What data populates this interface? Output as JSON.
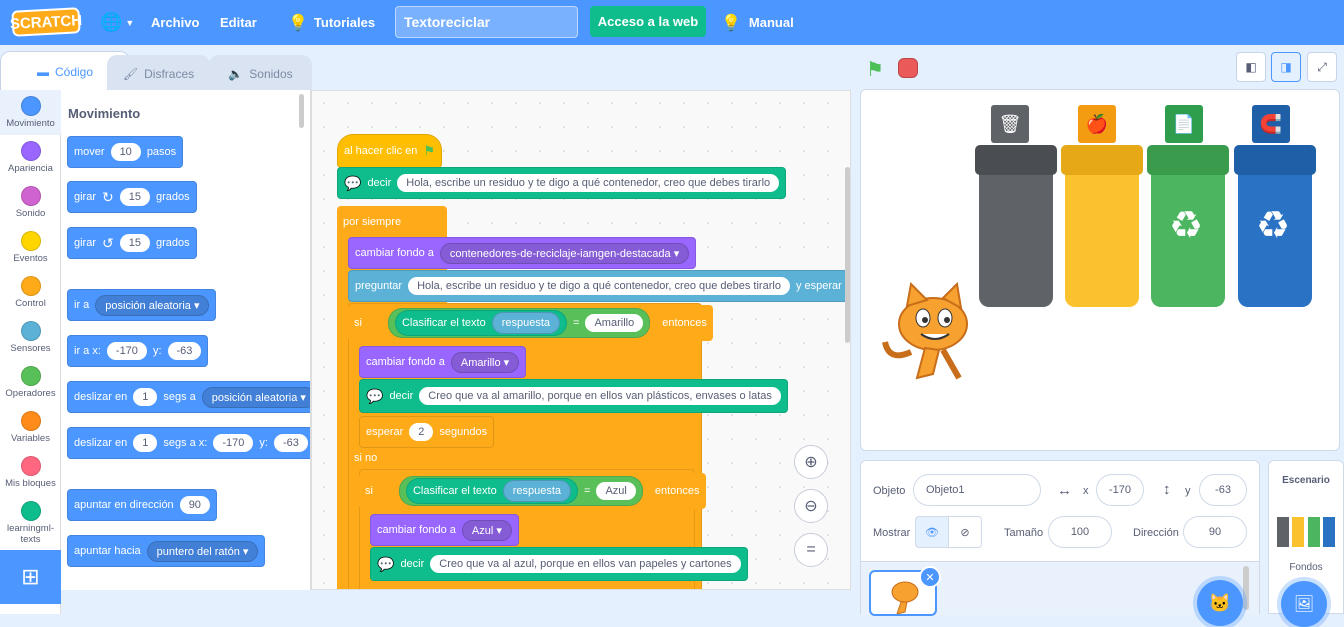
{
  "menubar": {
    "logo": "SCRATCH",
    "archivo": "Archivo",
    "editar": "Editar",
    "tutoriales": "Tutoriales",
    "project_title": "Textoreciclar",
    "web_button": "Acceso a la web",
    "manual": "Manual"
  },
  "tabs": {
    "code": "Código",
    "costumes": "Disfraces",
    "sounds": "Sonidos"
  },
  "categories": [
    {
      "label": "Movimiento",
      "color": "#4c97ff"
    },
    {
      "label": "Apariencia",
      "color": "#9966ff"
    },
    {
      "label": "Sonido",
      "color": "#cf63cf"
    },
    {
      "label": "Eventos",
      "color": "#ffd500"
    },
    {
      "label": "Control",
      "color": "#ffab19"
    },
    {
      "label": "Sensores",
      "color": "#5cb1d6"
    },
    {
      "label": "Operadores",
      "color": "#59c059"
    },
    {
      "label": "Variables",
      "color": "#ff8c1a"
    },
    {
      "label": "Mis bloques",
      "color": "#ff6680"
    },
    {
      "label": "learningml-texts",
      "color": "#0fbd8c"
    }
  ],
  "palette": {
    "heading": "Movimiento",
    "move": {
      "a": "mover",
      "v": "10",
      "b": "pasos"
    },
    "turn_right": {
      "a": "girar",
      "v": "15",
      "b": "grados"
    },
    "turn_left": {
      "a": "girar",
      "v": "15",
      "b": "grados"
    },
    "goto": {
      "a": "ir a",
      "dd": "posición aleatoria"
    },
    "goto_xy": {
      "a": "ir a x:",
      "x": "-170",
      "b": "y:",
      "y": "-63"
    },
    "glide": {
      "a": "deslizar en",
      "v": "1",
      "b": "segs a",
      "dd": "posición aleatoria"
    },
    "glide_xy": {
      "a": "deslizar en",
      "v": "1",
      "b": "segs a x:",
      "x": "-170",
      "c": "y:",
      "y": "-63"
    },
    "point_dir": {
      "a": "apuntar en dirección",
      "v": "90"
    },
    "point_towards": {
      "a": "apuntar hacia",
      "dd": "puntero del ratón"
    }
  },
  "script": {
    "hat": "al hacer clic en",
    "say1": {
      "a": "decir",
      "v": "Hola, escribe un residuo y te digo a qué contenedor, creo que debes tirarlo"
    },
    "forever": "por siempre",
    "switch_bg": {
      "a": "cambiar fondo a",
      "dd": "contenedores-de-reciclaje-iamgen-destacada"
    },
    "ask": {
      "a": "preguntar",
      "v": "Hola, escribe un residuo y te digo a qué contenedor, creo que debes tirarlo",
      "b": "y esperar"
    },
    "if1": {
      "si": "si",
      "classify": "Clasificar el texto",
      "answer": "respuesta",
      "eq": "=",
      "v": "Amarillo",
      "then": "entonces"
    },
    "switch_bg2": {
      "a": "cambiar fondo a",
      "dd": "Amarillo"
    },
    "say2": {
      "a": "decir",
      "v": "Creo que va al amarillo, porque en ellos van plásticos, envases o latas"
    },
    "wait": {
      "a": "esperar",
      "v": "2",
      "b": "segundos"
    },
    "else": "si no",
    "if2": {
      "si": "si",
      "classify": "Clasificar el texto",
      "answer": "respuesta",
      "eq": "=",
      "v": "Azul",
      "then": "entonces"
    },
    "switch_bg3": {
      "a": "cambiar fondo a",
      "dd": "Azul"
    },
    "say3": {
      "a": "decir",
      "v": "Creo que va al azul, porque en ellos van papeles y cartones"
    }
  },
  "sprite_info": {
    "obj_label": "Objeto",
    "obj_name": "Objeto1",
    "x_label": "x",
    "x": "-170",
    "y_label": "y",
    "y": "-63",
    "show_label": "Mostrar",
    "size_label": "Tamaño",
    "size": "100",
    "dir_label": "Dirección",
    "dir": "90"
  },
  "stage_panel": {
    "title": "Escenario",
    "backdrops": "Fondos"
  },
  "colors": {
    "accent": "#4c97ff",
    "gray_bin": "#5f6368",
    "yellow_bin": "#f9c22e",
    "green_bin": "#4cb560",
    "blue_bin": "#2a72c4"
  }
}
